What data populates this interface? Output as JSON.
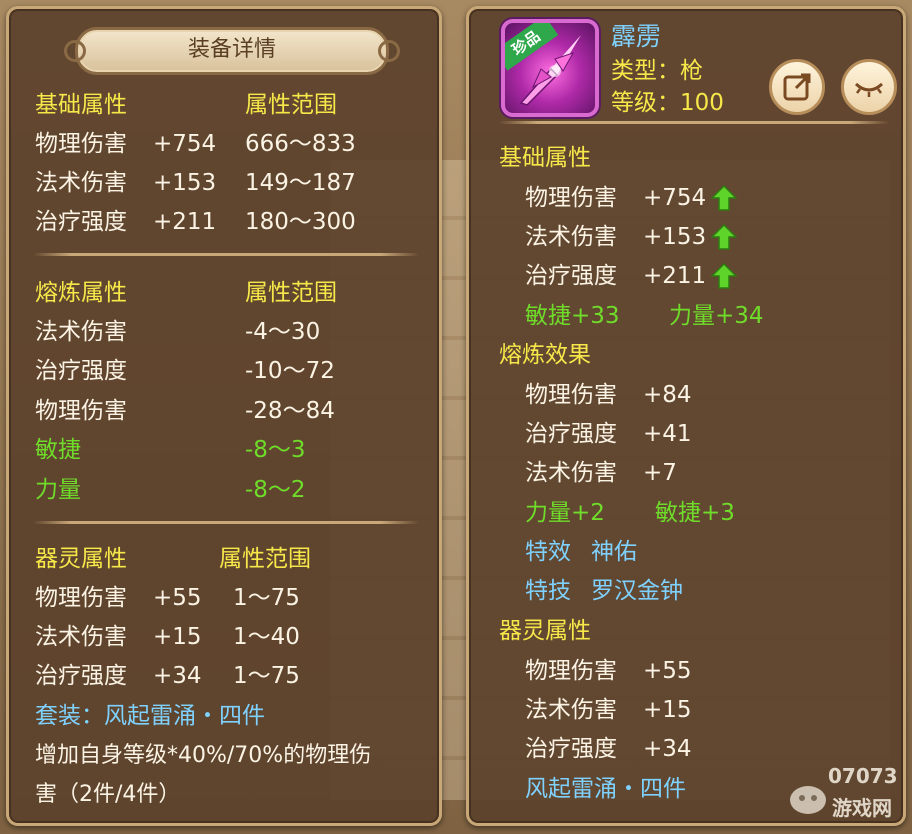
{
  "left": {
    "title": "装备详情",
    "base": {
      "header": "基础属性",
      "range_header": "属性范围",
      "rows": [
        {
          "name": "物理伤害",
          "value": "+754",
          "range": "666～833"
        },
        {
          "name": "法术伤害",
          "value": "+153",
          "range": "149～187"
        },
        {
          "name": "治疗强度",
          "value": "+211",
          "range": "180～300"
        }
      ]
    },
    "forge": {
      "header": "熔炼属性",
      "range_header": "属性范围",
      "rows": [
        {
          "name": "法术伤害",
          "range": "-4～30"
        },
        {
          "name": "治疗强度",
          "range": "-10～72"
        },
        {
          "name": "物理伤害",
          "range": "-28～84"
        },
        {
          "name": "敏捷",
          "range": "-8～3"
        },
        {
          "name": "力量",
          "range": "-8～2"
        }
      ]
    },
    "spirit": {
      "header": "器灵属性",
      "range_header": "属性范围",
      "rows": [
        {
          "name": "物理伤害",
          "value": "+55",
          "range": "1～75"
        },
        {
          "name": "法术伤害",
          "value": "+15",
          "range": "1～40"
        },
        {
          "name": "治疗强度",
          "value": "+34",
          "range": "1～75"
        }
      ]
    },
    "set_line": "套装：风起雷涌・四件",
    "desc_line1": "增加自身等级*40%/70%的物理伤",
    "desc_line2": "害（2件/4件）"
  },
  "right": {
    "item_name": "霹雳",
    "rarity": "珍品",
    "type_line": "类型：枪",
    "level_line": "等级：100",
    "base": {
      "header": "基础属性",
      "rows": [
        {
          "name": "物理伤害",
          "value": "+754"
        },
        {
          "name": "法术伤害",
          "value": "+153"
        },
        {
          "name": "治疗强度",
          "value": "+211"
        }
      ],
      "bonus1": "敏捷+33",
      "bonus2": "力量+34"
    },
    "forge": {
      "header": "熔炼效果",
      "rows": [
        {
          "name": "物理伤害",
          "value": "+84"
        },
        {
          "name": "治疗强度",
          "value": "+41"
        },
        {
          "name": "法术伤害",
          "value": "+7"
        }
      ],
      "bonus1": "力量+2",
      "bonus2": "敏捷+3",
      "effect_label": "特效",
      "effect_value": "神佑",
      "skill_label": "特技",
      "skill_value": "罗汉金钟"
    },
    "spirit": {
      "header": "器灵属性",
      "rows": [
        {
          "name": "物理伤害",
          "value": "+55"
        },
        {
          "name": "法术伤害",
          "value": "+15"
        },
        {
          "name": "治疗强度",
          "value": "+34"
        }
      ],
      "set_line": "风起雷涌・四件"
    }
  },
  "watermark": {
    "line1": "07073",
    "line2": "游戏网"
  },
  "colors": {
    "yellow": "#f7e84a",
    "white": "#fbf3e4",
    "green": "#6fdc2a",
    "cyan": "#7fd2ff",
    "panel": "#5c422c",
    "border": "#c9a878"
  }
}
